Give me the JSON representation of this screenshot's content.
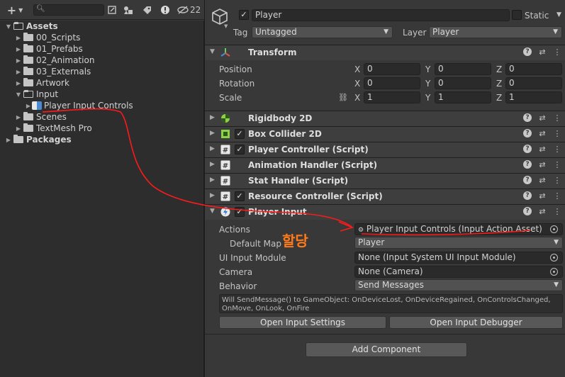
{
  "project": {
    "search_placeholder": "",
    "hidden_count": "22",
    "tree": [
      {
        "label": "Assets",
        "depth": 0,
        "folder": "open",
        "arrow": "▼",
        "bold": true
      },
      {
        "label": "00_Scripts",
        "depth": 1,
        "folder": "closed",
        "arrow": "▶",
        "bold": false
      },
      {
        "label": "01_Prefabs",
        "depth": 1,
        "folder": "closed",
        "arrow": "▶",
        "bold": false
      },
      {
        "label": "02_Animation",
        "depth": 1,
        "folder": "closed",
        "arrow": "▶",
        "bold": false
      },
      {
        "label": "03_Externals",
        "depth": 1,
        "folder": "closed",
        "arrow": "▶",
        "bold": false
      },
      {
        "label": "Artwork",
        "depth": 1,
        "folder": "closed",
        "arrow": "▶",
        "bold": false
      },
      {
        "label": "Input",
        "depth": 1,
        "folder": "open",
        "arrow": "▼",
        "bold": false
      },
      {
        "label": "Player Input Controls",
        "depth": 2,
        "folder": "asset",
        "arrow": "▶",
        "bold": false
      },
      {
        "label": "Scenes",
        "depth": 1,
        "folder": "closed",
        "arrow": "▶",
        "bold": false
      },
      {
        "label": "TextMesh Pro",
        "depth": 1,
        "folder": "closed",
        "arrow": "▶",
        "bold": false
      },
      {
        "label": "Packages",
        "depth": 0,
        "folder": "closed",
        "arrow": "▶",
        "bold": true
      }
    ]
  },
  "inspector": {
    "object_name": "Player",
    "static_label": "Static",
    "tag_label": "Tag",
    "tag_value": "Untagged",
    "layer_label": "Layer",
    "layer_value": "Player",
    "transform": {
      "title": "Transform",
      "rows": [
        {
          "label": "Position",
          "x": "0",
          "y": "0",
          "z": "0"
        },
        {
          "label": "Rotation",
          "x": "0",
          "y": "0",
          "z": "0"
        },
        {
          "label": "Scale",
          "x": "1",
          "y": "1",
          "z": "1"
        }
      ],
      "axis_x": "X",
      "axis_y": "Y",
      "axis_z": "Z"
    },
    "components": [
      {
        "title": "Rigidbody 2D",
        "icon": "rigidbody-icon",
        "has_check": false
      },
      {
        "title": "Box Collider 2D",
        "icon": "box-collider-icon",
        "has_check": true
      },
      {
        "title": "Player Controller (Script)",
        "icon": "script-icon",
        "has_check": true
      },
      {
        "title": "Animation Handler (Script)",
        "icon": "script-icon",
        "has_check": false
      },
      {
        "title": "Stat Handler (Script)",
        "icon": "script-icon",
        "has_check": false
      },
      {
        "title": "Resource Controller (Script)",
        "icon": "script-icon",
        "has_check": true
      },
      {
        "title": "Player Input",
        "icon": "player-input-icon",
        "has_check": true
      }
    ],
    "player_input": {
      "actions_label": "Actions",
      "actions_value": "Player Input Controls (Input Action Asset)",
      "default_map_label": "Default Map",
      "default_map_value": "Player",
      "ui_module_label": "UI Input Module",
      "ui_module_value": "None (Input System UI Input Module)",
      "camera_label": "Camera",
      "camera_value": "None (Camera)",
      "behavior_label": "Behavior",
      "behavior_value": "Send Messages",
      "help_text": "Will SendMessage() to GameObject: OnDeviceLost, OnDeviceRegained, OnControlsChanged, OnMove, OnLook, OnFire",
      "open_settings": "Open Input Settings",
      "open_debugger": "Open Input Debugger"
    },
    "add_component": "Add Component"
  },
  "annotation": {
    "note": "할당",
    "color": "#ff1a1a",
    "note_color": "#ff7a1a"
  }
}
